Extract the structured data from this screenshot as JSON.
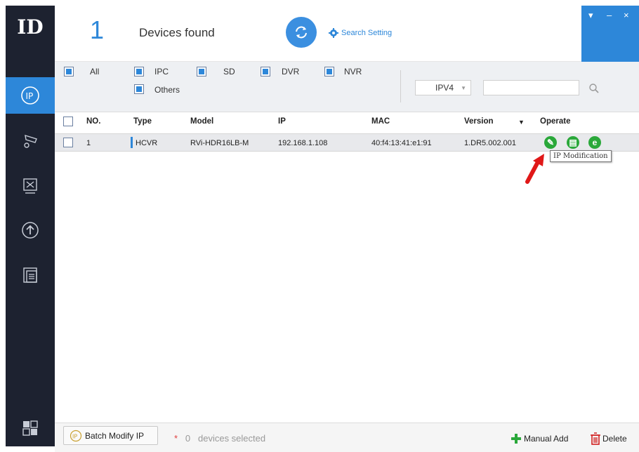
{
  "app": {
    "logo_text": "ID",
    "device_count": "1",
    "devices_found_label": "Devices found",
    "search_setting_label": "Search Setting",
    "accent_color": "#2d87d9",
    "sidebar_bg": "#1d2230"
  },
  "window_controls": [
    "▾",
    "–",
    "×"
  ],
  "filters": {
    "items": [
      {
        "label": "All",
        "checked": true
      },
      {
        "label": "IPC",
        "checked": true
      },
      {
        "label": "SD",
        "checked": true
      },
      {
        "label": "DVR",
        "checked": true
      },
      {
        "label": "NVR",
        "checked": true
      },
      {
        "label": "Others",
        "checked": true
      }
    ],
    "protocol_selected": "IPV4",
    "search_value": ""
  },
  "table": {
    "headers": [
      "NO.",
      "Type",
      "Model",
      "IP",
      "MAC",
      "Version",
      "Operate"
    ],
    "rows": [
      {
        "no": "1",
        "type": "HCVR",
        "model": "RVi-HDR16LB-M",
        "ip": "192.168.1.108",
        "mac": "40:f4:13:41:e1:91",
        "version": "1.DR5.002.001"
      }
    ]
  },
  "tooltip": "IP Modification",
  "bottom": {
    "batch_modify_label": "Batch Modify IP",
    "selected_star": "*",
    "selected_count": "0",
    "selected_suffix": "devices selected",
    "manual_add_label": "Manual Add",
    "delete_label": "Delete"
  },
  "icons": [
    "logo-icon",
    "ip-icon",
    "camera-config-icon",
    "tools-icon",
    "upgrade-icon",
    "docs-icon",
    "grid-icon",
    "refresh-icon",
    "gear-icon",
    "search-icon",
    "edit-icon",
    "web-config-icon",
    "browser-icon",
    "plus-icon",
    "trash-icon"
  ]
}
